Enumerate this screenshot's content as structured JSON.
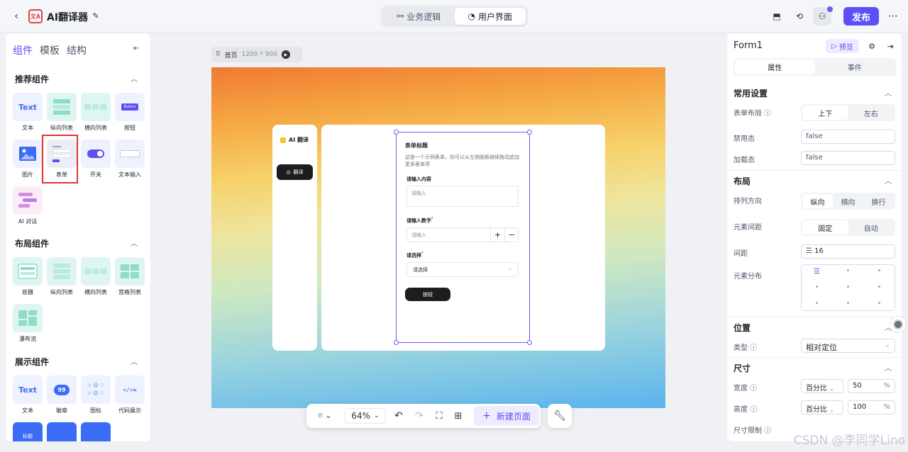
{
  "header": {
    "app_title": "AI翻译器",
    "tabs": [
      {
        "label": "业务逻辑"
      },
      {
        "label": "用户界面"
      }
    ],
    "publish_label": "发布"
  },
  "left_panel": {
    "tabs": [
      "组件",
      "模板",
      "结构"
    ],
    "sections": [
      {
        "title": "推荐组件",
        "items": [
          "文本",
          "纵向列表",
          "横向列表",
          "按钮",
          "图片",
          "表单",
          "开关",
          "文本输入",
          "AI 对话"
        ]
      },
      {
        "title": "布局组件",
        "items": [
          "容器",
          "纵向列表",
          "横向列表",
          "宫格列表",
          "瀑布流"
        ]
      },
      {
        "title": "展示组件",
        "items": [
          "文本",
          "徽章",
          "图标",
          "代码展示"
        ]
      }
    ],
    "tile_texts": {
      "text": "Text",
      "button": "Button",
      "badge": "99",
      "tag": "标题"
    }
  },
  "canvas": {
    "page_name": "首页",
    "page_size": "1200 * 900",
    "sidebar_title": "AI 翻译",
    "sidebar_button": "翻译",
    "form": {
      "title": "表单标题",
      "desc": "这是一个示例表单，你可以从左侧面板继续拖动追加更多表单项",
      "field1_label": "请输入内容",
      "field1_placeholder": "请输入",
      "field2_label": "请输入数字",
      "field2_placeholder": "请输入",
      "field3_label": "请选择",
      "field3_placeholder": "请选择",
      "required_mark": "*",
      "button": "按钮"
    }
  },
  "bottom_bar": {
    "zoom": "64%",
    "new_page": "新建页面"
  },
  "right_panel": {
    "title": "Form1",
    "preview": "预览",
    "tabs": [
      "属性",
      "事件"
    ],
    "common": {
      "title": "常用设置",
      "layout_label": "表单布局",
      "layout_options": [
        "上下",
        "左右"
      ],
      "disabled_label": "禁用态",
      "disabled_value": "false",
      "loading_label": "加载态",
      "loading_value": "false"
    },
    "layout": {
      "title": "布局",
      "direction_label": "排列方向",
      "direction_options": [
        "纵向",
        "横向",
        "换行"
      ],
      "gap_mode_label": "元素间距",
      "gap_mode_options": [
        "固定",
        "自动"
      ],
      "gap_label": "间距",
      "gap_value": "16",
      "distribution_label": "元素分布"
    },
    "position": {
      "title": "位置",
      "type_label": "类型",
      "type_value": "相对定位"
    },
    "size": {
      "title": "尺寸",
      "width_label": "宽度",
      "width_unit": "百分比",
      "width_value": "50",
      "height_label": "高度",
      "height_unit": "百分比",
      "height_value": "100",
      "percent": "%",
      "limit_label": "尺寸限制"
    }
  },
  "watermark": "CSDN @李同学Lino",
  "colors": {
    "accent": "#5b4ff5",
    "dark": "#1d1d1f",
    "selection": "#6a5cf0"
  }
}
